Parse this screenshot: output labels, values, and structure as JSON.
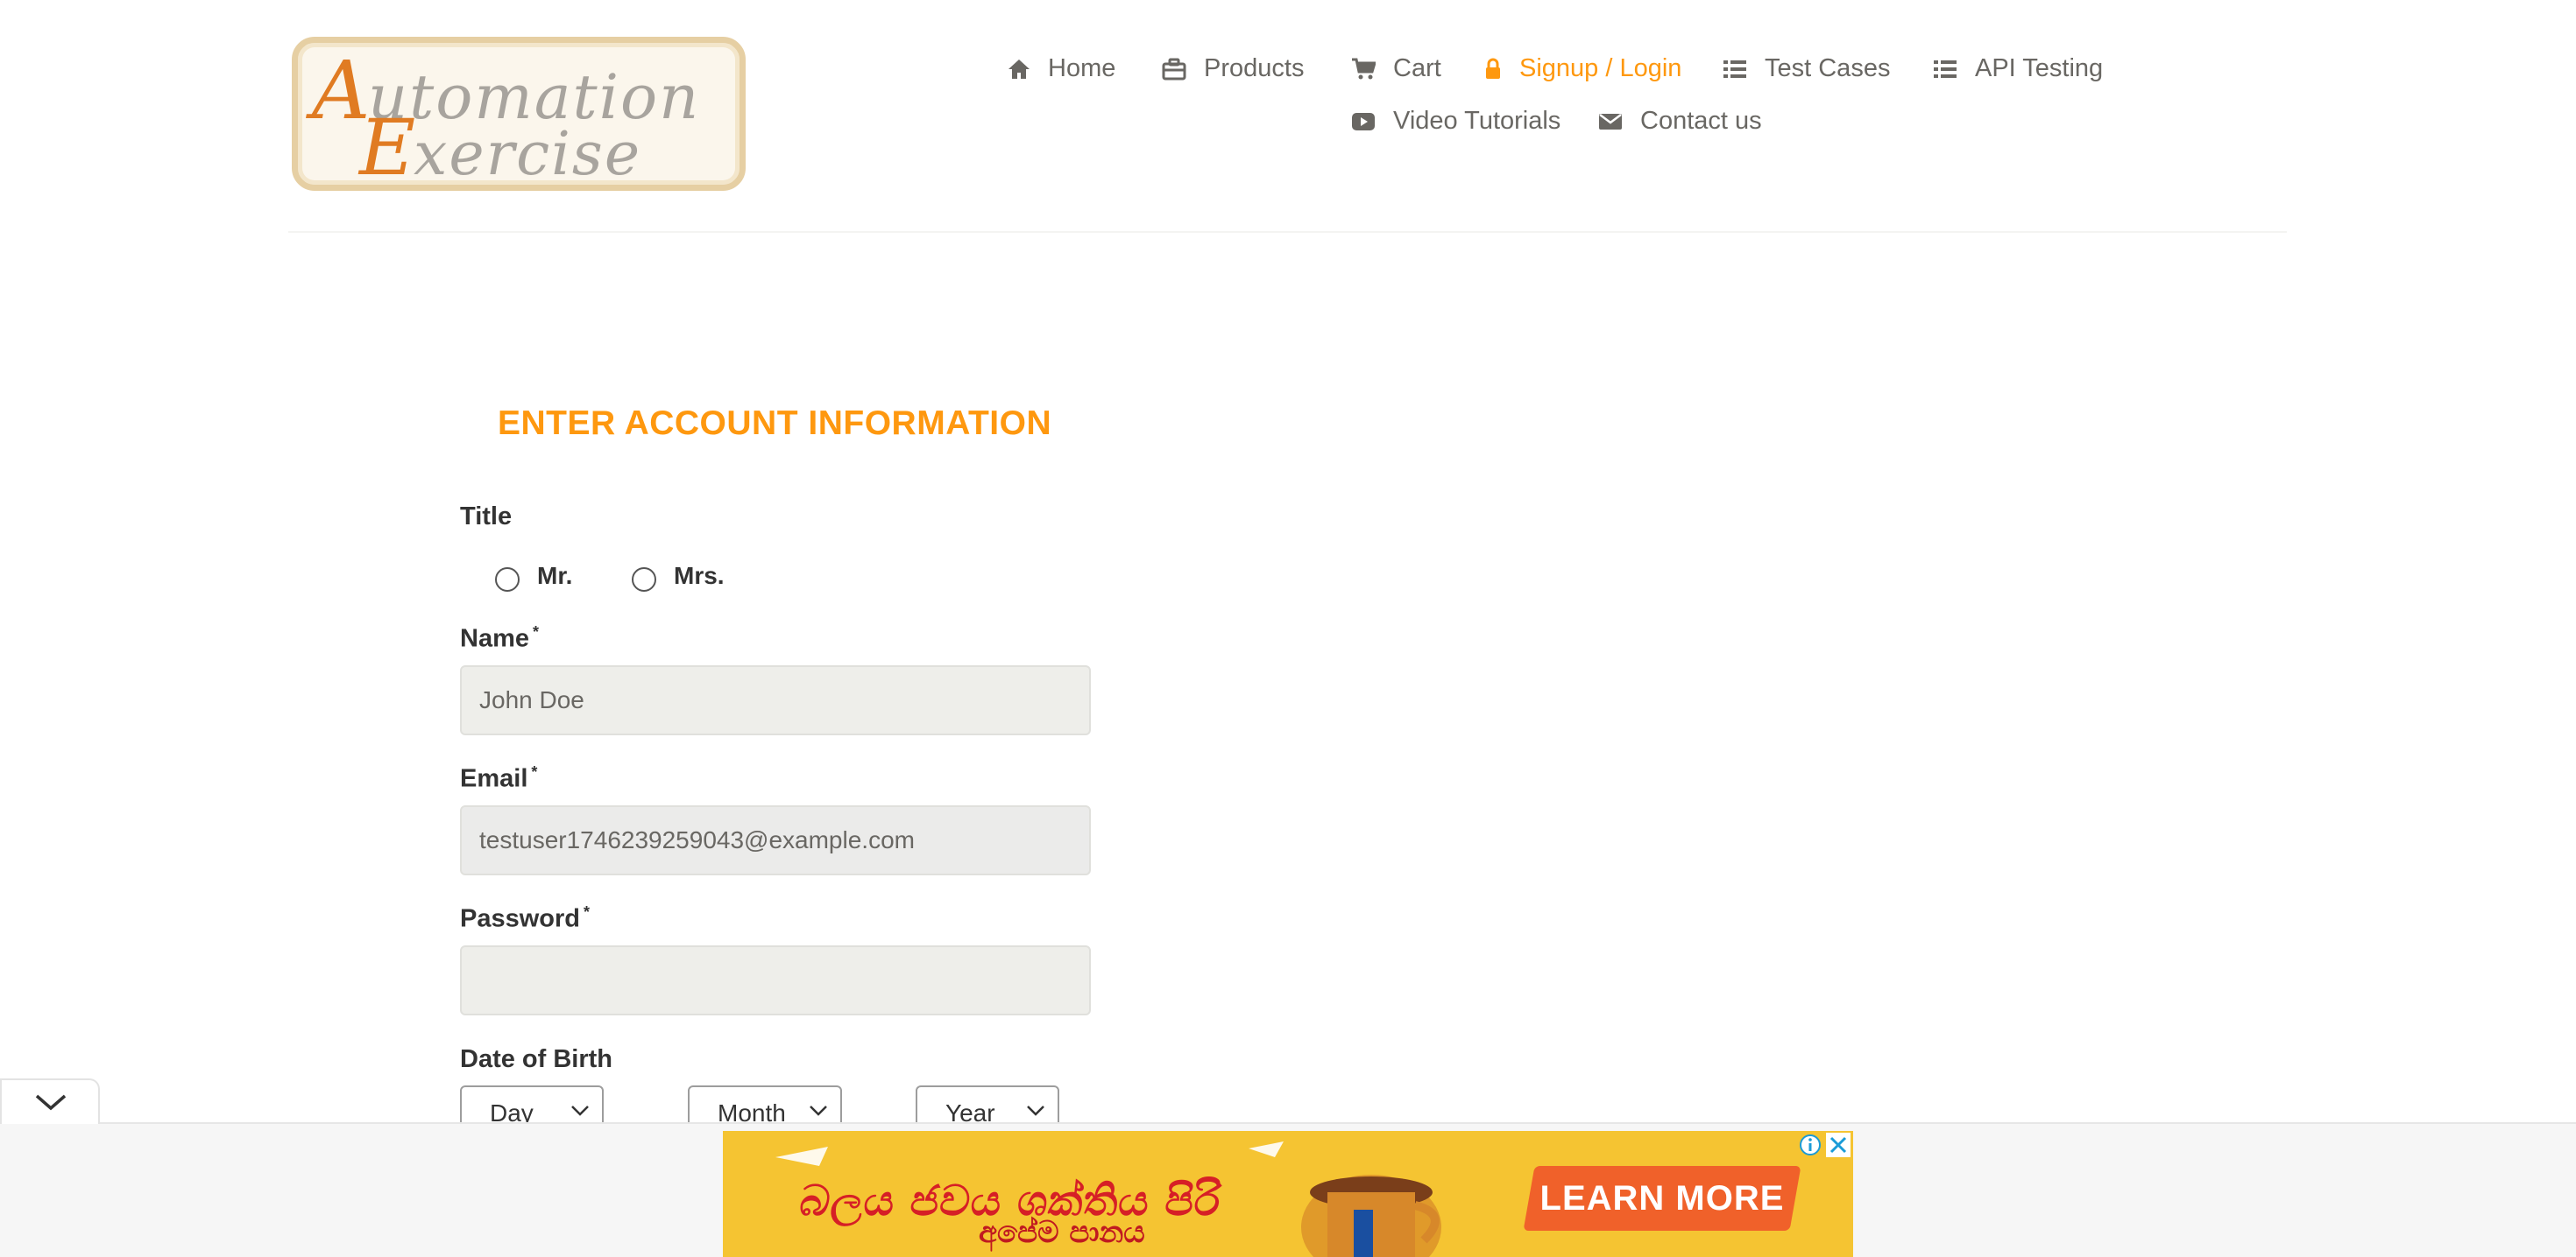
{
  "logo": {
    "alt": "Automation Exercise"
  },
  "nav": [
    {
      "label": "Home",
      "icon": "home-icon"
    },
    {
      "label": "Products",
      "icon": "briefcase-icon"
    },
    {
      "label": "Cart",
      "icon": "cart-icon"
    },
    {
      "label": "Signup / Login",
      "icon": "lock-icon",
      "active": true
    },
    {
      "label": "Test Cases",
      "icon": "list-icon"
    },
    {
      "label": "API Testing",
      "icon": "list-icon"
    },
    {
      "label": "Video Tutorials",
      "icon": "youtube-icon"
    },
    {
      "label": "Contact us",
      "icon": "envelope-icon"
    }
  ],
  "form": {
    "heading": "ENTER ACCOUNT INFORMATION",
    "title_label": "Title",
    "title_options": [
      "Mr.",
      "Mrs."
    ],
    "name_label": "Name",
    "name_value": "John Doe",
    "email_label": "Email",
    "email_value": "testuser1746239259043@example.com",
    "password_label": "Password",
    "password_value": "",
    "required_mark": "*",
    "dob_label": "Date of Birth",
    "dob_day": "Day",
    "dob_month": "Month",
    "dob_year": "Year"
  },
  "ad": {
    "headline": "බලය ජවය ශක්තිය පිරි",
    "subline": "අපේම පානය",
    "cta": "LEARN MORE",
    "info_icon": "info-icon",
    "close_icon": "close-icon"
  },
  "colors": {
    "accent": "#fe980f",
    "text": "#696763",
    "label": "#333333",
    "ad_bg": "#f5c432",
    "cta": "#f0612a"
  }
}
